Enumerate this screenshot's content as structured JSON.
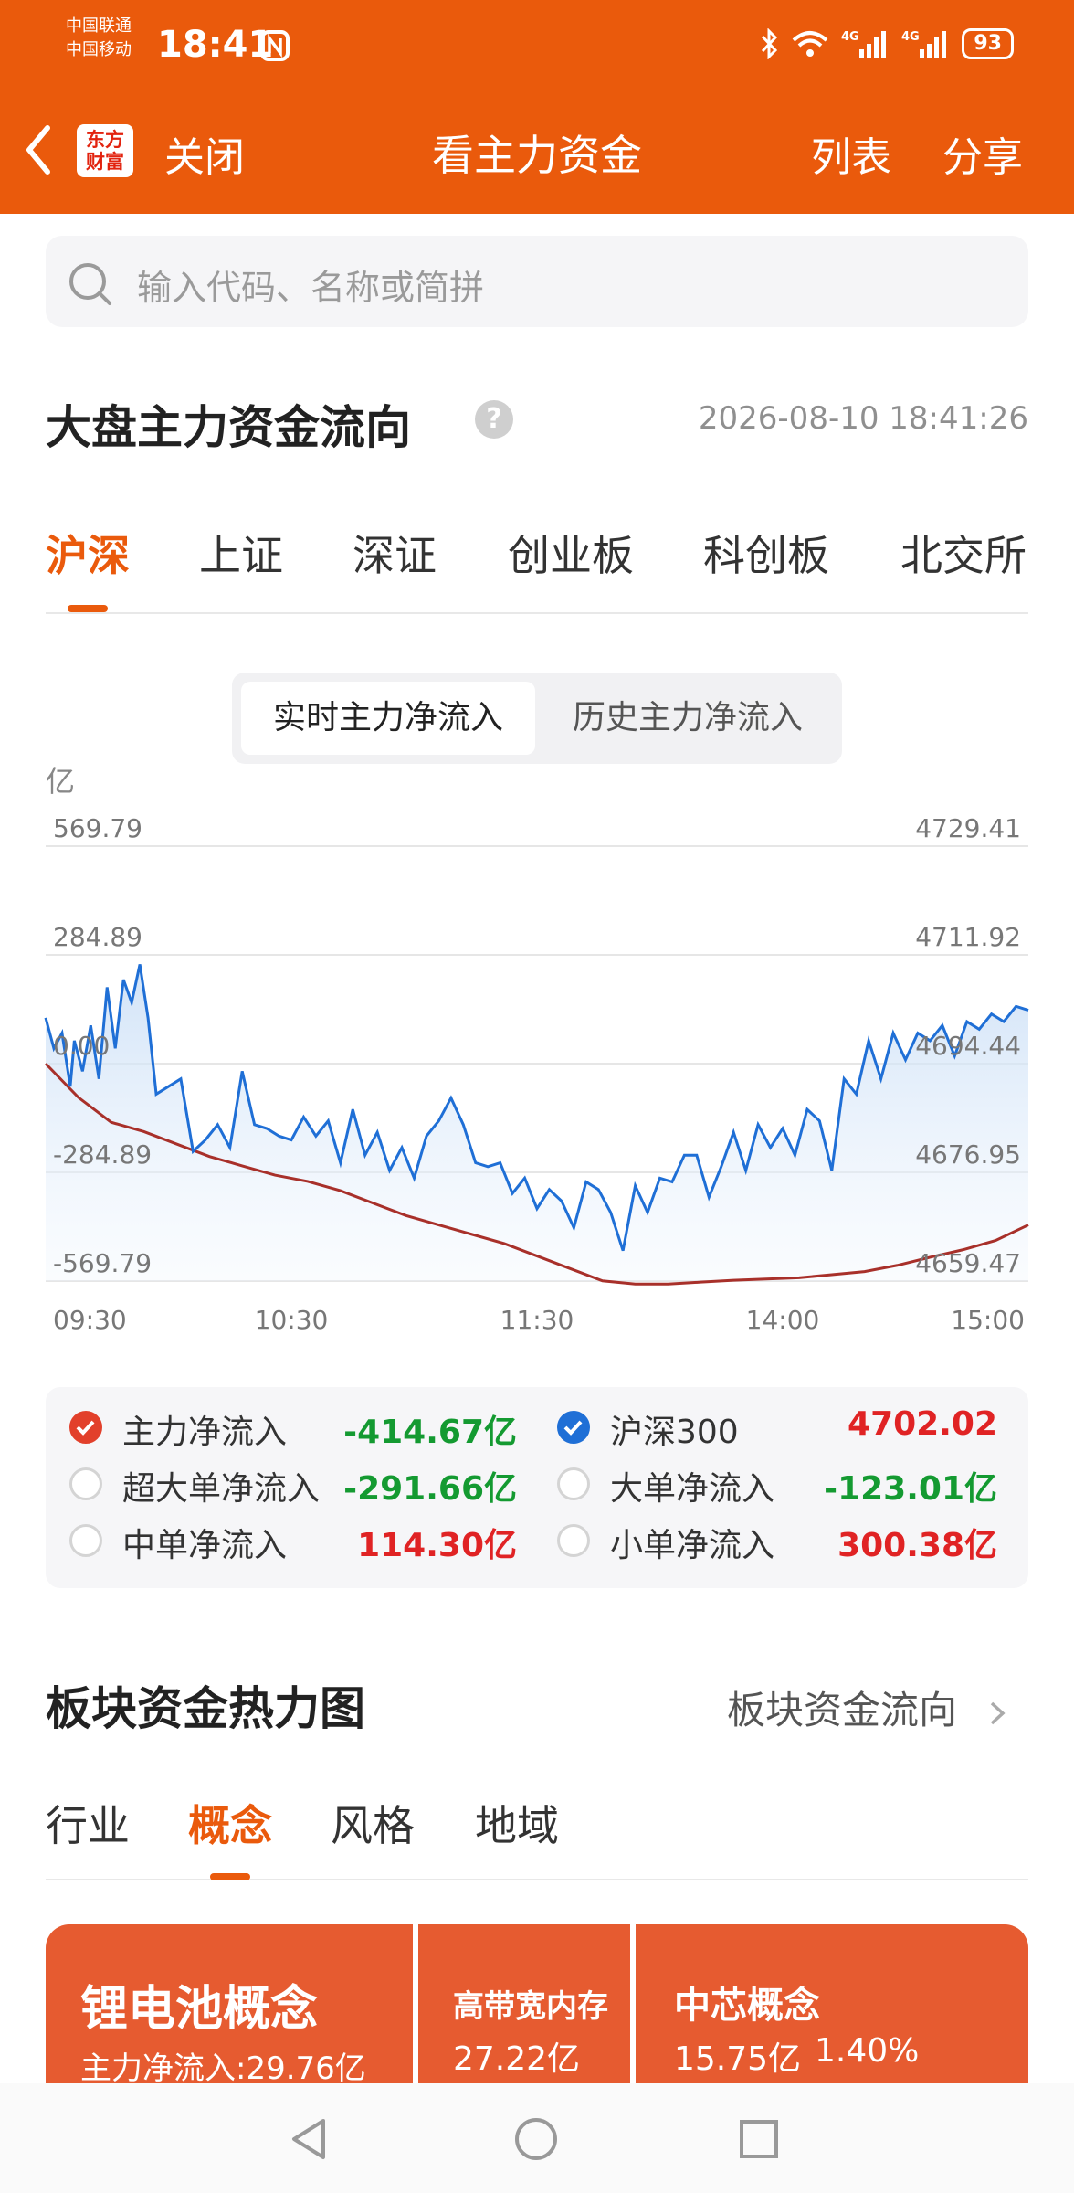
{
  "status_bar": {
    "carrier_1": "中国联通",
    "carrier_2": "中国移动",
    "time": "18:41",
    "network_1": "4G",
    "network_2": "4G",
    "battery": "93",
    "icons": [
      "nfc-icon",
      "bluetooth-icon",
      "wifi-icon",
      "signal-icon",
      "signal-icon",
      "battery-icon"
    ]
  },
  "nav": {
    "logo_line1": "东方",
    "logo_line2": "财富",
    "close_label": "关闭",
    "title": "看主力资金",
    "list_label": "列表",
    "share_label": "分享"
  },
  "search": {
    "placeholder": "输入代码、名称或简拼"
  },
  "market_flow": {
    "title": "大盘主力资金流向",
    "help": "?",
    "timestamp": "2026-08-10 18:41:26",
    "tabs": [
      "沪深",
      "上证",
      "深证",
      "创业板",
      "科创板",
      "北交所"
    ],
    "active_tab": 0,
    "toggle": {
      "realtime": "实时主力净流入",
      "history": "历史主力净流入",
      "active": "realtime"
    }
  },
  "chart_data": {
    "type": "line",
    "unit_label": "亿",
    "left_ticks": [
      "569.79",
      "284.89",
      "0.00",
      "-284.89",
      "-569.79"
    ],
    "right_ticks": [
      "4729.41",
      "4711.92",
      "4694.44",
      "4676.95",
      "4659.47"
    ],
    "x_ticks": [
      "09:30",
      "10:30",
      "11:30",
      "14:00",
      "15:00"
    ],
    "ylim_left": [
      -569.79,
      569.79
    ],
    "ylim_right": [
      4659.47,
      4729.41
    ],
    "grid": true,
    "series": [
      {
        "name": "主力净流入",
        "axis": "left",
        "color": "#1f6fd6",
        "x": [
          0,
          2,
          4,
          6,
          7,
          9,
          11,
          13,
          15,
          17,
          19,
          21,
          23,
          25,
          27,
          30,
          33,
          36,
          39,
          42,
          45,
          48,
          51,
          54,
          57,
          60,
          63,
          66,
          69,
          72,
          75,
          78,
          81,
          84,
          87,
          90,
          93,
          96,
          99,
          102,
          105,
          108,
          111,
          114,
          117,
          120,
          123,
          126,
          129,
          132,
          135,
          138,
          141,
          144,
          147,
          150,
          153,
          156,
          159,
          162,
          165,
          168,
          171,
          174,
          177,
          180,
          183,
          186,
          189,
          192,
          195,
          198,
          201,
          204,
          207,
          210,
          213,
          216,
          219,
          222,
          225,
          228,
          231,
          234,
          237,
          240
        ],
        "values": [
          120,
          40,
          80,
          -60,
          60,
          -20,
          100,
          -40,
          200,
          40,
          220,
          160,
          260,
          120,
          -80,
          -60,
          -40,
          -230,
          -200,
          -160,
          -220,
          -20,
          -160,
          -170,
          -190,
          -200,
          -140,
          -190,
          -150,
          -260,
          -120,
          -240,
          -180,
          -280,
          -220,
          -300,
          -190,
          -150,
          -90,
          -160,
          -260,
          -270,
          -260,
          -340,
          -300,
          -380,
          -330,
          -360,
          -430,
          -310,
          -330,
          -390,
          -490,
          -320,
          -390,
          -300,
          -310,
          -240,
          -240,
          -350,
          -270,
          -180,
          -280,
          -160,
          -220,
          -170,
          -240,
          -120,
          -150,
          -280,
          -40,
          -80,
          60,
          -40,
          80,
          10,
          80,
          60,
          100,
          20,
          110,
          90,
          130,
          110,
          150,
          140
        ]
      },
      {
        "name": "沪深300",
        "axis": "right",
        "color": "#a8302a",
        "x": [
          0,
          8,
          16,
          24,
          32,
          40,
          48,
          56,
          64,
          72,
          80,
          88,
          96,
          104,
          112,
          120,
          128,
          136,
          144,
          152,
          160,
          168,
          176,
          184,
          192,
          200,
          208,
          216,
          224,
          232,
          240
        ],
        "values": [
          4694.44,
          4689,
          4685,
          4683.5,
          4681.5,
          4679.5,
          4678,
          4676.5,
          4675.5,
          4674,
          4672,
          4670,
          4668.5,
          4667,
          4665.5,
          4663.5,
          4661.5,
          4659.5,
          4659,
          4659,
          4659.3,
          4659.6,
          4659.8,
          4660,
          4660.5,
          4661,
          4662,
          4663.3,
          4664.5,
          4666,
          4668.5
        ]
      }
    ],
    "legend": [
      {
        "label": "主力净流入",
        "value": "-414.67亿",
        "checked": true,
        "check_color": "#e2402b",
        "value_color": "#149a31"
      },
      {
        "label": "沪深300",
        "value": "4702.02",
        "checked": true,
        "check_color": "#1f6fd6",
        "value_color": "#e02324"
      },
      {
        "label": "超大单净流入",
        "value": "-291.66亿",
        "checked": false,
        "value_color": "#149a31"
      },
      {
        "label": "大单净流入",
        "value": "-123.01亿",
        "checked": false,
        "value_color": "#149a31"
      },
      {
        "label": "中单净流入",
        "value": "114.30亿",
        "checked": false,
        "value_color": "#e02324"
      },
      {
        "label": "小单净流入",
        "value": "300.38亿",
        "checked": false,
        "value_color": "#e02324"
      }
    ]
  },
  "heatmap_section": {
    "title": "板块资金热力图",
    "link_label": "板块资金流向",
    "tabs": [
      "行业",
      "概念",
      "风格",
      "地域"
    ],
    "active_tab": 1,
    "tiles": [
      {
        "name": "锂电池概念",
        "value": "主力净流入:29.76亿"
      },
      {
        "name": "高带宽内存",
        "value": "27.22亿"
      },
      {
        "name": "中芯概念",
        "value": "15.75亿",
        "pct": "1.40%"
      }
    ]
  },
  "system_nav": {
    "icons": [
      "back-triangle-icon",
      "home-circle-icon",
      "recents-square-icon"
    ]
  }
}
